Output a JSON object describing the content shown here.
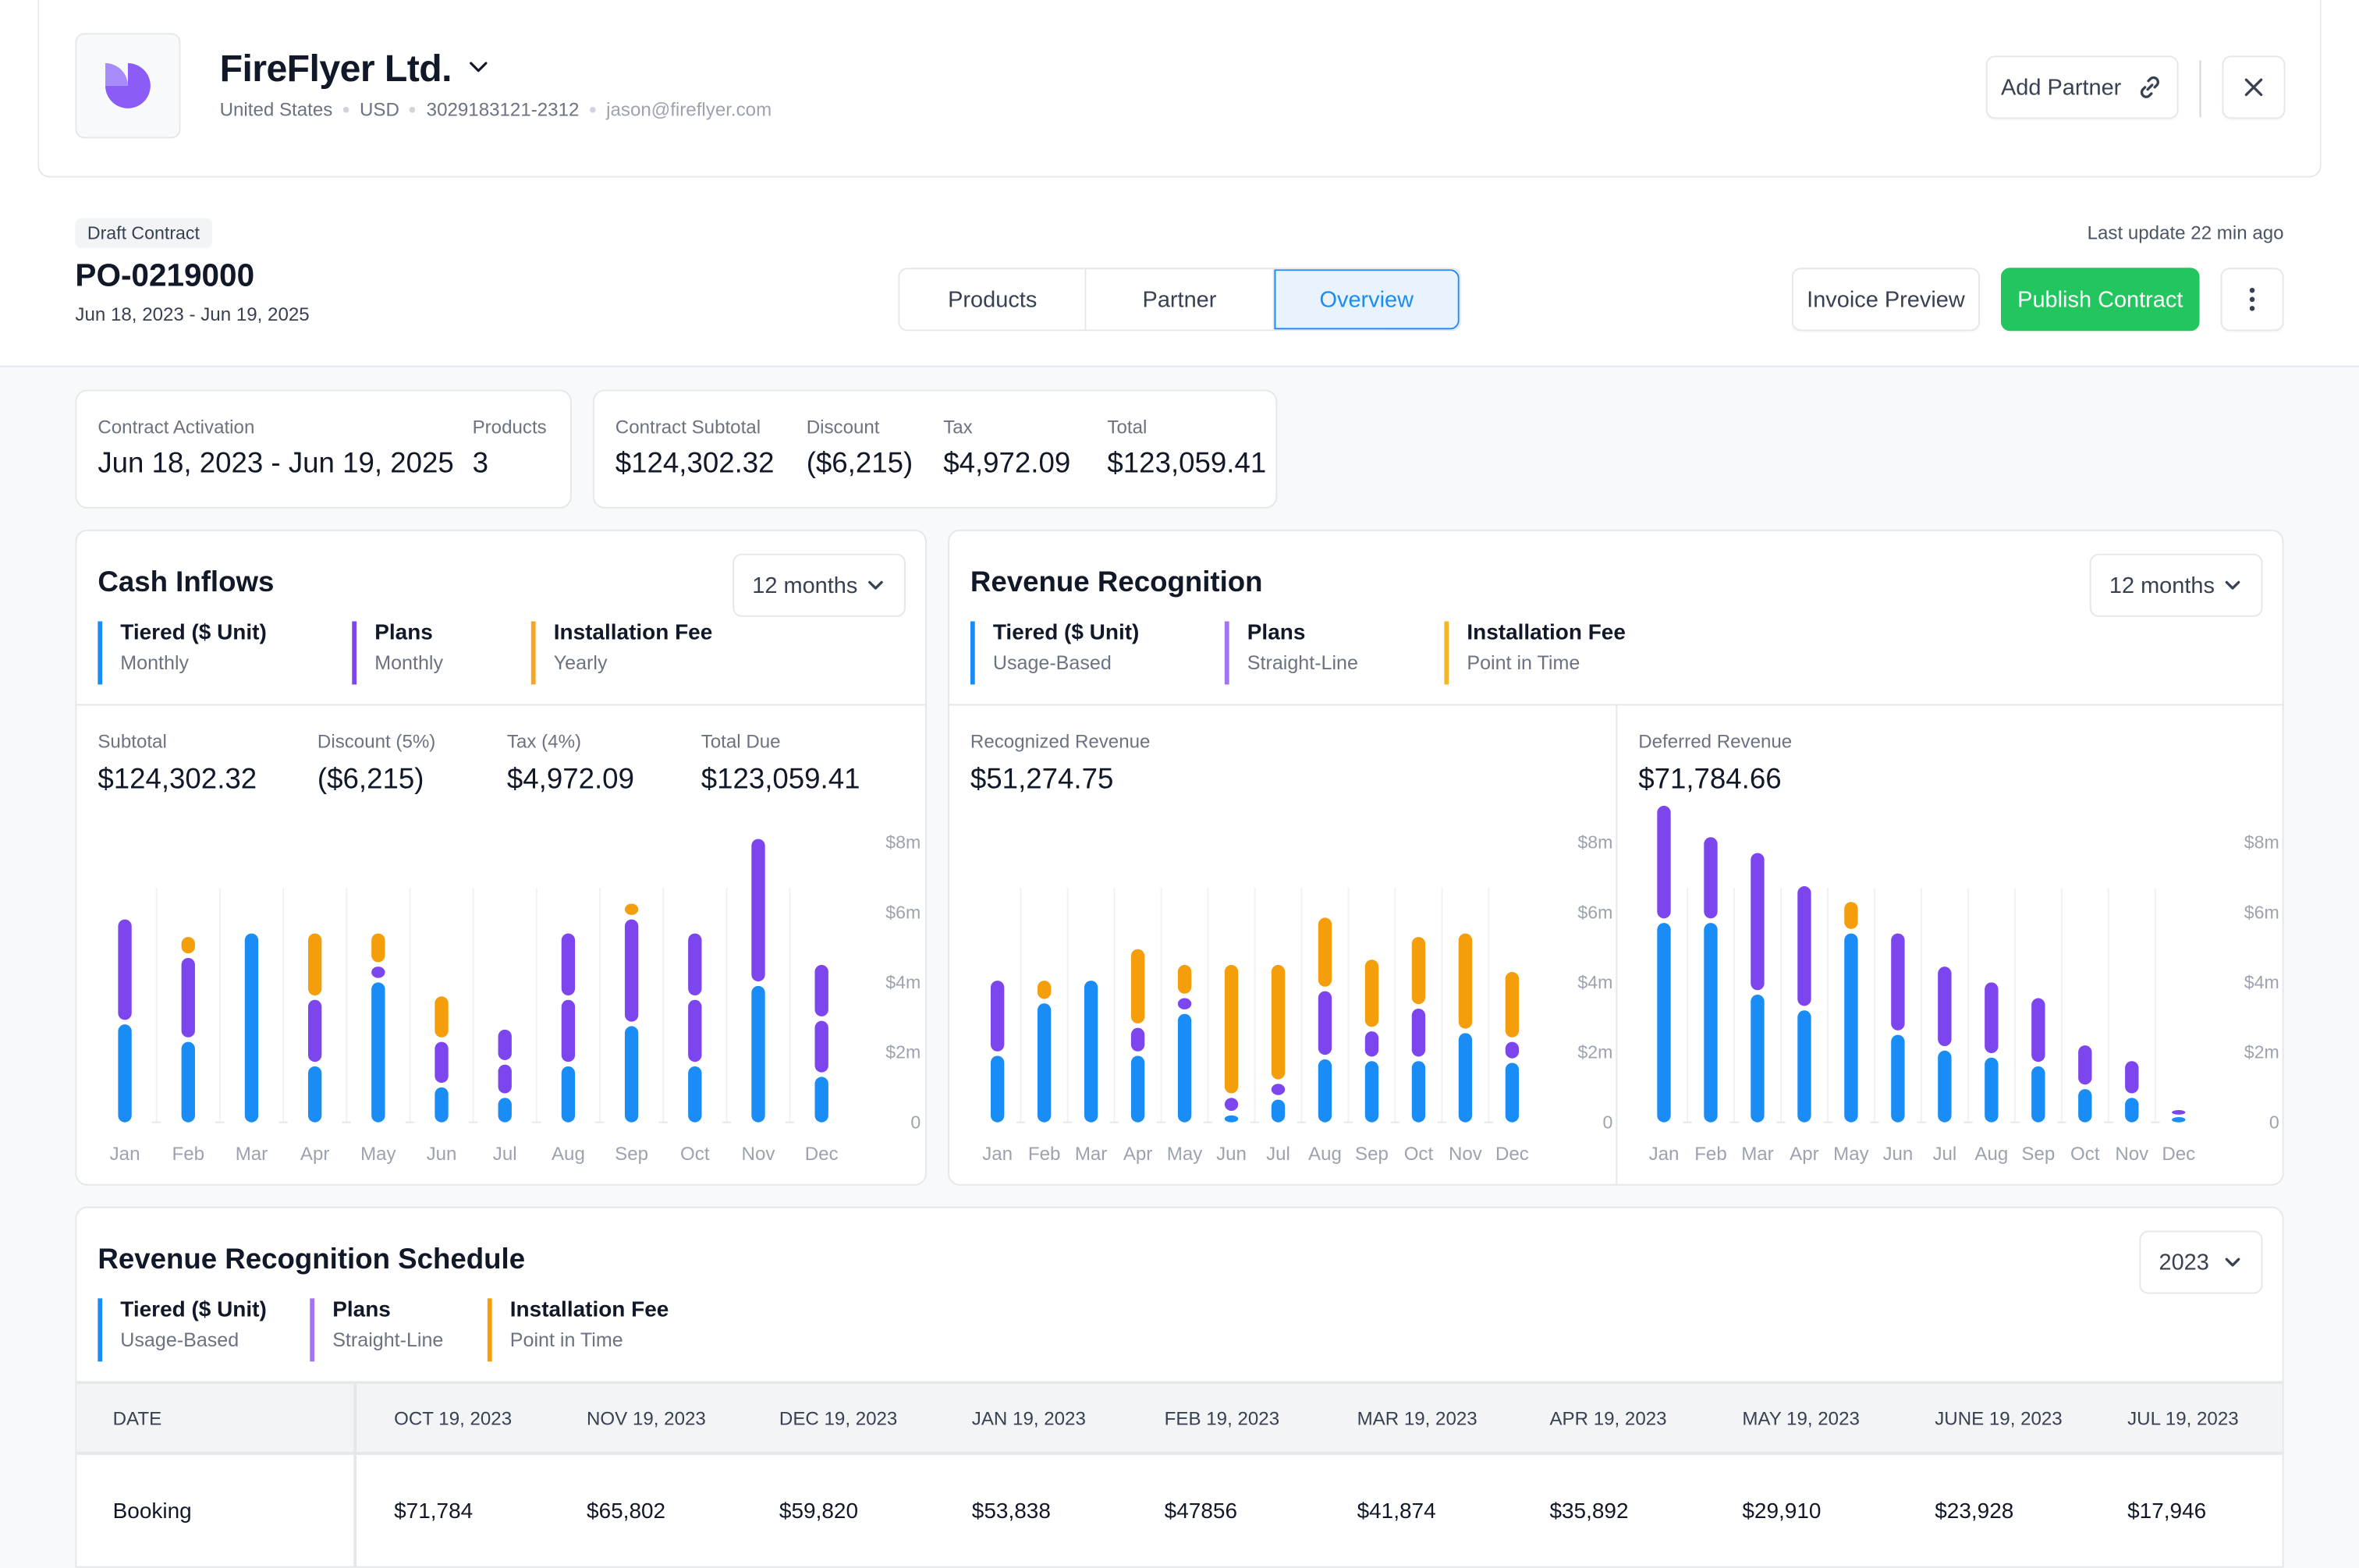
{
  "company": {
    "name": "FireFlyer Ltd.",
    "country": "United States",
    "currency": "USD",
    "phone": "3029183121-2312",
    "email": "jason@fireflyer.com",
    "logo_icon": "pie-logo-icon",
    "brand_color": "#8b5cf6"
  },
  "header_actions": {
    "add_partner_label": "Add Partner",
    "add_partner_icon": "link-icon",
    "close_icon": "close-icon"
  },
  "contract": {
    "status_badge": "Draft Contract",
    "number": "PO-0219000",
    "dates": "Jun 18, 2023 - Jun 19, 2025",
    "last_update": "Last update 22 min ago"
  },
  "tabs": [
    {
      "label": "Products",
      "active": false
    },
    {
      "label": "Partner",
      "active": false
    },
    {
      "label": "Overview",
      "active": true
    }
  ],
  "actions": {
    "invoice_preview": "Invoice Preview",
    "publish": "Publish Contract",
    "more_icon": "more-vertical-icon",
    "publish_color": "#22c55e",
    "accent_color": "#1a8cf5"
  },
  "summary": {
    "activation_label": "Contract Activation",
    "activation_value": "Jun 18, 2023 - Jun 19, 2025",
    "products_label": "Products",
    "products_value": "3",
    "subtotal_label": "Contract Subtotal",
    "subtotal_value": "$124,302.32",
    "discount_label": "Discount",
    "discount_value": "($6,215)",
    "tax_label": "Tax",
    "tax_value": "$4,972.09",
    "total_label": "Total",
    "total_value": "$123,059.41"
  },
  "series_colors": {
    "tiered": "#1a8cf5",
    "plans": "#7c45ee",
    "installation": "#f59e0b"
  },
  "cash_inflows": {
    "title": "Cash Inflows",
    "period": "12 months",
    "legend": [
      {
        "title": "Tiered ($ Unit)",
        "sub": "Monthly",
        "color": "#1a8cf5"
      },
      {
        "title": "Plans",
        "sub": "Monthly",
        "color": "#7c45ee"
      },
      {
        "title": "Installation Fee",
        "sub": "Yearly",
        "color": "#f5a524"
      }
    ],
    "metrics": [
      {
        "label": "Subtotal",
        "value": "$124,302.32"
      },
      {
        "label": "Discount (5%)",
        "value": "($6,215)"
      },
      {
        "label": "Tax (4%)",
        "value": "$4,972.09"
      },
      {
        "label": "Total Due",
        "value": "$123,059.41"
      }
    ]
  },
  "revenue_recognition": {
    "title": "Revenue Recognition",
    "period": "12 months",
    "legend": [
      {
        "title": "Tiered ($ Unit)",
        "sub": "Usage-Based",
        "color": "#1a8cf5"
      },
      {
        "title": "Plans",
        "sub": "Straight-Line",
        "color": "#a473ef"
      },
      {
        "title": "Installation Fee",
        "sub": "Point in Time",
        "color": "#f5b524"
      }
    ],
    "recognized": {
      "label": "Recognized Revenue",
      "value": "$51,274.75"
    },
    "deferred": {
      "label": "Deferred Revenue",
      "value": "$71,784.66"
    }
  },
  "chart_data": [
    {
      "type": "bar",
      "stacked": true,
      "title": "Cash Inflows",
      "categories": [
        "Jan",
        "Feb",
        "Mar",
        "Apr",
        "May",
        "Jun",
        "Jul",
        "Aug",
        "Sep",
        "Oct",
        "Nov",
        "Dec"
      ],
      "ylim": [
        0,
        8
      ],
      "yticks": [
        "0",
        "$2m",
        "$4m",
        "$6m",
        "$8m"
      ],
      "ylabel_unit": "$m",
      "grid": true,
      "segments": [
        [
          {
            "s": "tiered",
            "v": 2.8
          },
          {
            "s": "plans",
            "v": 3.0
          }
        ],
        [
          {
            "s": "tiered",
            "v": 2.3
          },
          {
            "s": "plans",
            "v": 2.4
          },
          {
            "s": "installation",
            "v": 0.6
          }
        ],
        [
          {
            "s": "tiered",
            "v": 5.4
          }
        ],
        [
          {
            "s": "tiered",
            "v": 1.6
          },
          {
            "s": "plans",
            "v": 1.9
          },
          {
            "s": "installation",
            "v": 1.9
          }
        ],
        [
          {
            "s": "tiered",
            "v": 4.0
          },
          {
            "s": "plans",
            "v": 0.45
          },
          {
            "s": "installation",
            "v": 0.95
          }
        ],
        [
          {
            "s": "tiered",
            "v": 1.0
          },
          {
            "s": "plans",
            "v": 1.3
          },
          {
            "s": "installation",
            "v": 1.3
          }
        ],
        [
          {
            "s": "tiered",
            "v": 0.7
          },
          {
            "s": "plans",
            "v": 0.95
          },
          {
            "s": "plans",
            "v": 1.0
          }
        ],
        [
          {
            "s": "tiered",
            "v": 1.6
          },
          {
            "s": "plans",
            "v": 1.9
          },
          {
            "s": "plans",
            "v": 1.9
          }
        ],
        [
          {
            "s": "tiered",
            "v": 2.75
          },
          {
            "s": "plans",
            "v": 3.05
          },
          {
            "s": "installation",
            "v": 0.45
          }
        ],
        [
          {
            "s": "tiered",
            "v": 1.6
          },
          {
            "s": "plans",
            "v": 1.9
          },
          {
            "s": "plans",
            "v": 1.9
          }
        ],
        [
          {
            "s": "tiered",
            "v": 3.9
          },
          {
            "s": "plans",
            "v": 4.2
          }
        ],
        [
          {
            "s": "tiered",
            "v": 1.3
          },
          {
            "s": "plans",
            "v": 1.6
          },
          {
            "s": "plans",
            "v": 1.6
          }
        ]
      ]
    },
    {
      "type": "bar",
      "stacked": true,
      "title": "Recognized Revenue",
      "categories": [
        "Jan",
        "Feb",
        "Mar",
        "Apr",
        "May",
        "Jun",
        "Jul",
        "Aug",
        "Sep",
        "Oct",
        "Nov",
        "Dec"
      ],
      "ylim": [
        0,
        8
      ],
      "yticks": [
        "0",
        "$2m",
        "$4m",
        "$6m",
        "$8m"
      ],
      "ylabel_unit": "$m",
      "grid": true,
      "segments": [
        [
          {
            "s": "tiered",
            "v": 1.9
          },
          {
            "s": "plans",
            "v": 2.15
          }
        ],
        [
          {
            "s": "tiered",
            "v": 3.4
          },
          {
            "s": "installation",
            "v": 0.65
          }
        ],
        [
          {
            "s": "tiered",
            "v": 4.05
          }
        ],
        [
          {
            "s": "tiered",
            "v": 1.9
          },
          {
            "s": "plans",
            "v": 0.8
          },
          {
            "s": "installation",
            "v": 2.25
          }
        ],
        [
          {
            "s": "tiered",
            "v": 3.1
          },
          {
            "s": "plans",
            "v": 0.45
          },
          {
            "s": "installation",
            "v": 0.95
          }
        ],
        [
          {
            "s": "tiered",
            "v": 0.2
          },
          {
            "s": "plans",
            "v": 0.5
          },
          {
            "s": "installation",
            "v": 3.8
          }
        ],
        [
          {
            "s": "tiered",
            "v": 0.65
          },
          {
            "s": "plans",
            "v": 0.45
          },
          {
            "s": "installation",
            "v": 3.4
          }
        ],
        [
          {
            "s": "tiered",
            "v": 1.8
          },
          {
            "s": "plans",
            "v": 1.95
          },
          {
            "s": "installation",
            "v": 2.1
          }
        ],
        [
          {
            "s": "tiered",
            "v": 1.75
          },
          {
            "s": "plans",
            "v": 0.85
          },
          {
            "s": "installation",
            "v": 2.05
          }
        ],
        [
          {
            "s": "tiered",
            "v": 1.75
          },
          {
            "s": "plans",
            "v": 1.5
          },
          {
            "s": "installation",
            "v": 2.05
          }
        ],
        [
          {
            "s": "tiered",
            "v": 2.55
          },
          {
            "s": "installation",
            "v": 2.85
          }
        ],
        [
          {
            "s": "tiered",
            "v": 1.7
          },
          {
            "s": "plans",
            "v": 0.6
          },
          {
            "s": "installation",
            "v": 2.0
          }
        ]
      ]
    },
    {
      "type": "bar",
      "stacked": true,
      "title": "Deferred Revenue",
      "categories": [
        "Jan",
        "Feb",
        "Mar",
        "Apr",
        "May",
        "Jun",
        "Jul",
        "Aug",
        "Sep",
        "Oct",
        "Nov",
        "Dec"
      ],
      "ylim": [
        0,
        8
      ],
      "yticks": [
        "0",
        "$2m",
        "$4m",
        "$6m",
        "$8m"
      ],
      "ylabel_unit": "$m",
      "grid": true,
      "segments": [
        [
          {
            "s": "tiered",
            "v": 5.7
          },
          {
            "s": "plans",
            "v": 3.35
          }
        ],
        [
          {
            "s": "tiered",
            "v": 5.7
          },
          {
            "s": "plans",
            "v": 2.45
          }
        ],
        [
          {
            "s": "tiered",
            "v": 3.65
          },
          {
            "s": "plans",
            "v": 4.05
          }
        ],
        [
          {
            "s": "tiered",
            "v": 3.2
          },
          {
            "s": "plans",
            "v": 3.55
          }
        ],
        [
          {
            "s": "tiered",
            "v": 5.4
          },
          {
            "s": "installation",
            "v": 0.9
          }
        ],
        [
          {
            "s": "tiered",
            "v": 2.5
          },
          {
            "s": "plans",
            "v": 2.9
          }
        ],
        [
          {
            "s": "tiered",
            "v": 2.05
          },
          {
            "s": "plans",
            "v": 2.4
          }
        ],
        [
          {
            "s": "tiered",
            "v": 1.85
          },
          {
            "s": "plans",
            "v": 2.15
          }
        ],
        [
          {
            "s": "tiered",
            "v": 1.6
          },
          {
            "s": "plans",
            "v": 1.95
          }
        ],
        [
          {
            "s": "tiered",
            "v": 0.95
          },
          {
            "s": "plans",
            "v": 1.25
          }
        ],
        [
          {
            "s": "tiered",
            "v": 0.7
          },
          {
            "s": "plans",
            "v": 1.05
          }
        ],
        [
          {
            "s": "tiered",
            "v": 0.15
          },
          {
            "s": "plans",
            "v": 0.2
          }
        ]
      ]
    }
  ],
  "schedule": {
    "title": "Revenue Recognition Schedule",
    "year": "2023",
    "legend": [
      {
        "title": "Tiered ($ Unit)",
        "sub": "Usage-Based",
        "color": "#1a8cf5"
      },
      {
        "title": "Plans",
        "sub": "Straight-Line",
        "color": "#a473ef"
      },
      {
        "title": "Installation Fee",
        "sub": "Point in Time",
        "color": "#f59e0b"
      }
    ],
    "columns": [
      "DATE",
      "OCT 19, 2023",
      "NOV 19, 2023",
      "DEC 19, 2023",
      "JAN 19, 2023",
      "FEB 19, 2023",
      "MAR 19, 2023",
      "APR 19, 2023",
      "MAY 19, 2023",
      "JUNE 19, 2023",
      "JUL 19, 2023"
    ],
    "rows": [
      {
        "label": "Booking",
        "values": [
          "$71,784",
          "$65,802",
          "$59,820",
          "$53,838",
          "$47856",
          "$41,874",
          "$35,892",
          "$29,910",
          "$23,928",
          "$17,946"
        ]
      }
    ]
  }
}
